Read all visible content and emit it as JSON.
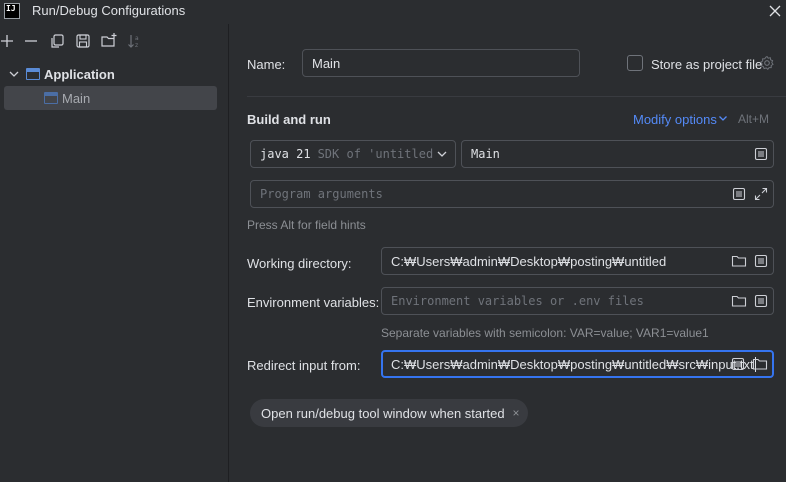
{
  "window": {
    "title": "Run/Debug Configurations",
    "logo_text": "IJ"
  },
  "toolbar": {
    "icons": [
      "add-icon",
      "remove-icon",
      "copy-icon",
      "save-icon",
      "new-folder-icon",
      "sort-icon"
    ]
  },
  "tree": {
    "group_label": "Application",
    "item_label": "Main"
  },
  "form": {
    "name_label": "Name:",
    "name_value": "Main",
    "store_label": "Store as project file",
    "build_run_title": "Build and run",
    "modify_options_label": "Modify options",
    "modify_options_shortcut": "Alt+M",
    "sdk_version": "java 21",
    "sdk_description": "SDK of 'untitled",
    "main_class_value": "Main",
    "program_args_placeholder": "Program arguments",
    "field_hint": "Press Alt for field hints",
    "working_dir_label": "Working directory:",
    "working_dir_value": "C:₩Users₩admin₩Desktop₩posting₩untitled",
    "env_label": "Environment variables:",
    "env_placeholder": "Environment variables or .env files",
    "env_hint": "Separate variables with semicolon: VAR=value; VAR1=value1",
    "redirect_label": "Redirect input from:",
    "redirect_value": "C:₩Users₩admin₩Desktop₩posting₩untitled₩src₩input.txt",
    "chip_label": "Open run/debug tool window when started",
    "chip_close": "×"
  },
  "colors": {
    "background": "#2b2d30",
    "accent": "#3574f0",
    "link": "#548af7",
    "border": "#4e5157"
  }
}
